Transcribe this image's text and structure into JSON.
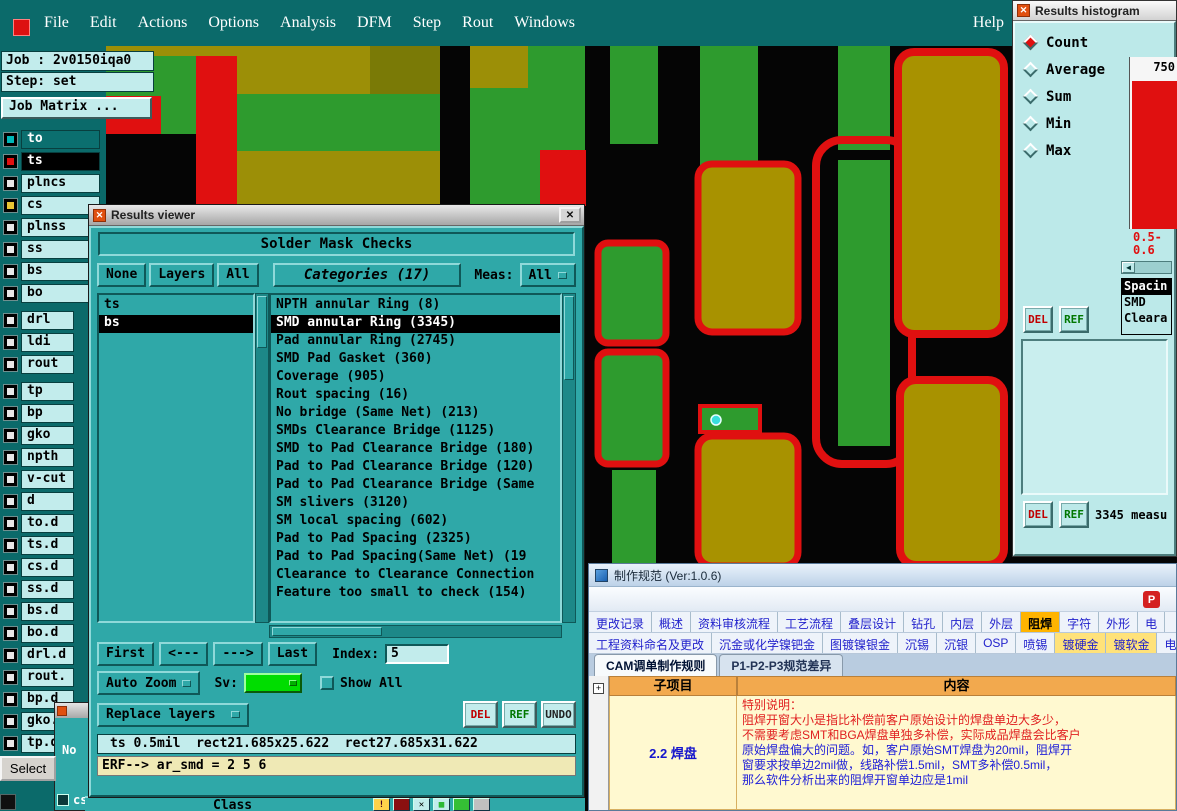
{
  "menu_bar": {
    "items": [
      "File",
      "Edit",
      "Actions",
      "Options",
      "Analysis",
      "DFM",
      "Step",
      "Rout",
      "Windows"
    ],
    "help_item": "Help"
  },
  "job_panel": {
    "job_label": "Job : 2v0150iqa0",
    "step_label": "Step: set",
    "matrix_button_label": "Job Matrix ..."
  },
  "layer_list": [
    {
      "label": "to",
      "cls": "sel-teal",
      "ind": "#00b6b6"
    },
    {
      "label": "ts",
      "cls": "sel-black",
      "ind": "#e01010"
    },
    {
      "label": "plncs",
      "ind": "#e8e8e8"
    },
    {
      "label": "cs",
      "ind": "#e8c433"
    },
    {
      "label": "plnss",
      "ind": "#e8e8e8"
    },
    {
      "label": "ss",
      "ind": "#e8e8e8"
    },
    {
      "label": "bs",
      "ind": "#e8e8e8"
    },
    {
      "label": "bo",
      "ind": "#e8e8e8"
    },
    {
      "label": "drl",
      "cls": "narrow gap",
      "ind": "#e8e8e8"
    },
    {
      "label": "ldi",
      "cls": "narrow",
      "ind": "#e8e8e8"
    },
    {
      "label": "rout",
      "cls": "narrow",
      "ind": "#e8e8e8"
    },
    {
      "label": "tp",
      "cls": "narrow gap",
      "ind": "#e8e8e8"
    },
    {
      "label": "bp",
      "cls": "narrow",
      "ind": "#e8e8e8"
    },
    {
      "label": "gko",
      "cls": "narrow",
      "ind": "#e8e8e8"
    },
    {
      "label": "npth",
      "cls": "narrow",
      "ind": "#e8e8e8"
    },
    {
      "label": "v-cut",
      "cls": "narrow",
      "ind": "#e8e8e8"
    },
    {
      "label": "d",
      "cls": "narrow",
      "ind": "#e8e8e8"
    },
    {
      "label": "to.d",
      "cls": "narrow",
      "ind": "#e8e8e8"
    },
    {
      "label": "ts.d",
      "cls": "narrow",
      "ind": "#e8e8e8"
    },
    {
      "label": "cs.d",
      "cls": "narrow",
      "ind": "#e8e8e8"
    },
    {
      "label": "ss.d",
      "cls": "narrow",
      "ind": "#e8e8e8"
    },
    {
      "label": "bs.d",
      "cls": "narrow",
      "ind": "#e8e8e8"
    },
    {
      "label": "bo.d",
      "cls": "narrow",
      "ind": "#e8e8e8"
    },
    {
      "label": "drl.d",
      "cls": "narrow",
      "ind": "#e8e8e8"
    },
    {
      "label": "rout.",
      "cls": "narrow",
      "ind": "#e8e8e8"
    },
    {
      "label": "bp.d",
      "cls": "narrow",
      "ind": "#e8e8e8"
    },
    {
      "label": "gko.d",
      "cls": "narrow",
      "ind": "#e8e8e8"
    },
    {
      "label": "tp.d",
      "cls": "narrow",
      "ind": "#e8e8e8"
    }
  ],
  "results_viewer": {
    "title": "Results viewer",
    "close_glyph": "✕",
    "header": "Solder Mask Checks",
    "filters": [
      {
        "label": "None"
      },
      {
        "label": "Layers",
        "cls": "bold"
      },
      {
        "label": "All"
      }
    ],
    "categories_button": "Categories (17)",
    "meas_label": "Meas:",
    "meas_value": "All",
    "layers": [
      {
        "label": "ts"
      },
      {
        "label": "bs",
        "cls": "selected"
      }
    ],
    "categories": [
      {
        "label": "NPTH annular Ring (8)"
      },
      {
        "label": "SMD annular Ring (3345)",
        "cls": "selected"
      },
      {
        "label": "Pad annular Ring (2745)"
      },
      {
        "label": "SMD Pad Gasket (360)"
      },
      {
        "label": "Coverage (905)"
      },
      {
        "label": "Rout spacing (16)"
      },
      {
        "label": "No bridge (Same Net) (213)"
      },
      {
        "label": "SMDs Clearance Bridge (1125)"
      },
      {
        "label": "SMD to Pad Clearance Bridge (180)"
      },
      {
        "label": "Pad to Pad Clearance Bridge (120)"
      },
      {
        "label": "Pad to Pad Clearance Bridge (Same"
      },
      {
        "label": "SM slivers (3120)"
      },
      {
        "label": "SM local spacing (602)"
      },
      {
        "label": "Pad to Pad Spacing (2325)"
      },
      {
        "label": "Pad to Pad Spacing(Same Net) (19"
      },
      {
        "label": "Clearance to Clearance Connection"
      },
      {
        "label": "Feature too small to check (154)"
      }
    ],
    "nav": {
      "first": "First",
      "prev": "<---",
      "next": "--->",
      "last": "Last",
      "index_label": "Index:",
      "index_value": "5"
    },
    "auto_zoom": "Auto Zoom",
    "sv_label": "Sv:",
    "sv_color": "#00dd00",
    "show_all": "Show All",
    "replace_layers": "Replace layers",
    "action_buttons": [
      {
        "label": "DEL",
        "cls": "red"
      },
      {
        "label": "REF",
        "cls": "green"
      },
      {
        "label": "UNDO",
        "cls": "dark"
      }
    ],
    "status_line": "ts 0.5mil  rect21.685x25.622  rect27.685x31.622",
    "erf_line": "ERF--> ar_smd = 2 5 6"
  },
  "histogram": {
    "title": "Results histogram",
    "options": [
      {
        "label": "Count",
        "cls": "selected"
      },
      {
        "label": "Average"
      },
      {
        "label": "Sum"
      },
      {
        "label": "Min"
      },
      {
        "label": "Max"
      }
    ],
    "y_max": "750",
    "bin_label_line1": "0.5-",
    "bin_label_line2": "0.6",
    "legend": [
      {
        "label": "Spacin",
        "cls": "selected"
      },
      {
        "label": "SMD"
      },
      {
        "label": "Cleara"
      }
    ],
    "del_label": "DEL",
    "ref_label": "REF",
    "measure_text": "3345 measu",
    "bar_color": "#e01010"
  },
  "spec_window": {
    "title": "制作规范 (Ver:1.0.6)",
    "toolbar_icon_label": "P",
    "tabs_row1": [
      {
        "label": "更改记录"
      },
      {
        "label": "概述"
      },
      {
        "label": "资料审核流程"
      },
      {
        "label": "工艺流程"
      },
      {
        "label": "叠层设计"
      },
      {
        "label": "钻孔"
      },
      {
        "label": "内层"
      },
      {
        "label": "外层"
      },
      {
        "label": "阻焊",
        "cls": "selected"
      },
      {
        "label": "字符"
      },
      {
        "label": "外形"
      },
      {
        "label": "电"
      }
    ],
    "tabs_row2": [
      {
        "label": "工程资料命名及更改"
      },
      {
        "label": "沉金或化学镍钯金"
      },
      {
        "label": "图镀镍银金"
      },
      {
        "label": "沉锡"
      },
      {
        "label": "沉银"
      },
      {
        "label": "OSP"
      },
      {
        "label": "喷锡"
      },
      {
        "label": "镀硬金",
        "cls": "hl"
      },
      {
        "label": "镀软金",
        "cls": "hl"
      },
      {
        "label": "电"
      }
    ],
    "tabs_row3": [
      {
        "label": "CAM调单制作规则",
        "cls": "active"
      },
      {
        "label": "P1-P2-P3规范差异"
      }
    ],
    "table": {
      "col1_header": "子项目",
      "col2_header": "内容",
      "row_label": "2.2 焊盘",
      "content_lines": [
        {
          "text": "特别说明：",
          "cls": "red"
        },
        {
          "text": "阻焊开窗大小是指比补偿前客户原始设计的焊盘单边大多少，",
          "cls": "red"
        },
        {
          "text": "不需要考虑SMT和BGA焊盘单独多补偿，实际成品焊盘会比客户",
          "cls": "red"
        },
        {
          "text": "原始焊盘偏大的问题。如，客户原始SMT焊盘为20mil，阻焊开",
          "cls": "blue"
        },
        {
          "text": "窗要求按单边2mil做，线路补偿1.5mil，SMT多补偿0.5mil，",
          "cls": "blue"
        },
        {
          "text": "那么软件分析出来的阻焊开窗单边应是1mil",
          "cls": "blue"
        }
      ],
      "expander_glyph": "+"
    }
  },
  "misc": {
    "select_button": "Select",
    "no_label": "No",
    "cs_label": "cs",
    "class_label": "Class",
    "warn_glyph": "!",
    "close_glyph": "✕"
  }
}
